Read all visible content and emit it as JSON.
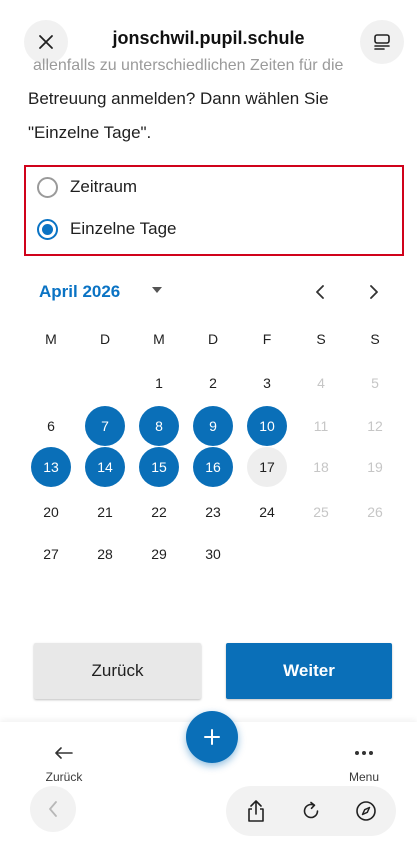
{
  "topbar": {
    "title": "jonschwil.pupil.schule",
    "close_icon": "close-icon",
    "reader_icon": "reader-mode-icon"
  },
  "content": {
    "faded_text": "allenfalls zu unterschiedlichen Zeiten für die",
    "intro_text": "Betreuung anmelden? Dann wählen Sie \"Einzelne Tage\"."
  },
  "radio": {
    "options": [
      {
        "label": "Zeitraum",
        "checked": false
      },
      {
        "label": "Einzelne Tage",
        "checked": true
      }
    ],
    "border_color": "#d0021b"
  },
  "calendar": {
    "month_label": "April 2026",
    "weekdays": [
      "M",
      "D",
      "M",
      "D",
      "F",
      "S",
      "S"
    ],
    "weeks": [
      [
        "",
        "",
        "1",
        "2",
        "3",
        "4",
        "5"
      ],
      [
        "6",
        "7",
        "8",
        "9",
        "10",
        "11",
        "12"
      ],
      [
        "13",
        "14",
        "15",
        "16",
        "17",
        "18",
        "19"
      ],
      [
        "20",
        "21",
        "22",
        "23",
        "24",
        "25",
        "26"
      ],
      [
        "27",
        "28",
        "29",
        "30",
        "",
        "",
        ""
      ]
    ],
    "selected_days": [
      "7",
      "8",
      "9",
      "10",
      "13",
      "14",
      "15",
      "16"
    ],
    "today": "17",
    "muted_days": [
      "4",
      "5",
      "11",
      "12",
      "18",
      "19",
      "25",
      "26"
    ],
    "accent": "#0a6fb8"
  },
  "actions": {
    "back_label": "Zurück",
    "next_label": "Weiter"
  },
  "bottom_nav": {
    "back_label": "Zurück",
    "menu_label": "Menu",
    "fab_icon": "plus-icon"
  }
}
